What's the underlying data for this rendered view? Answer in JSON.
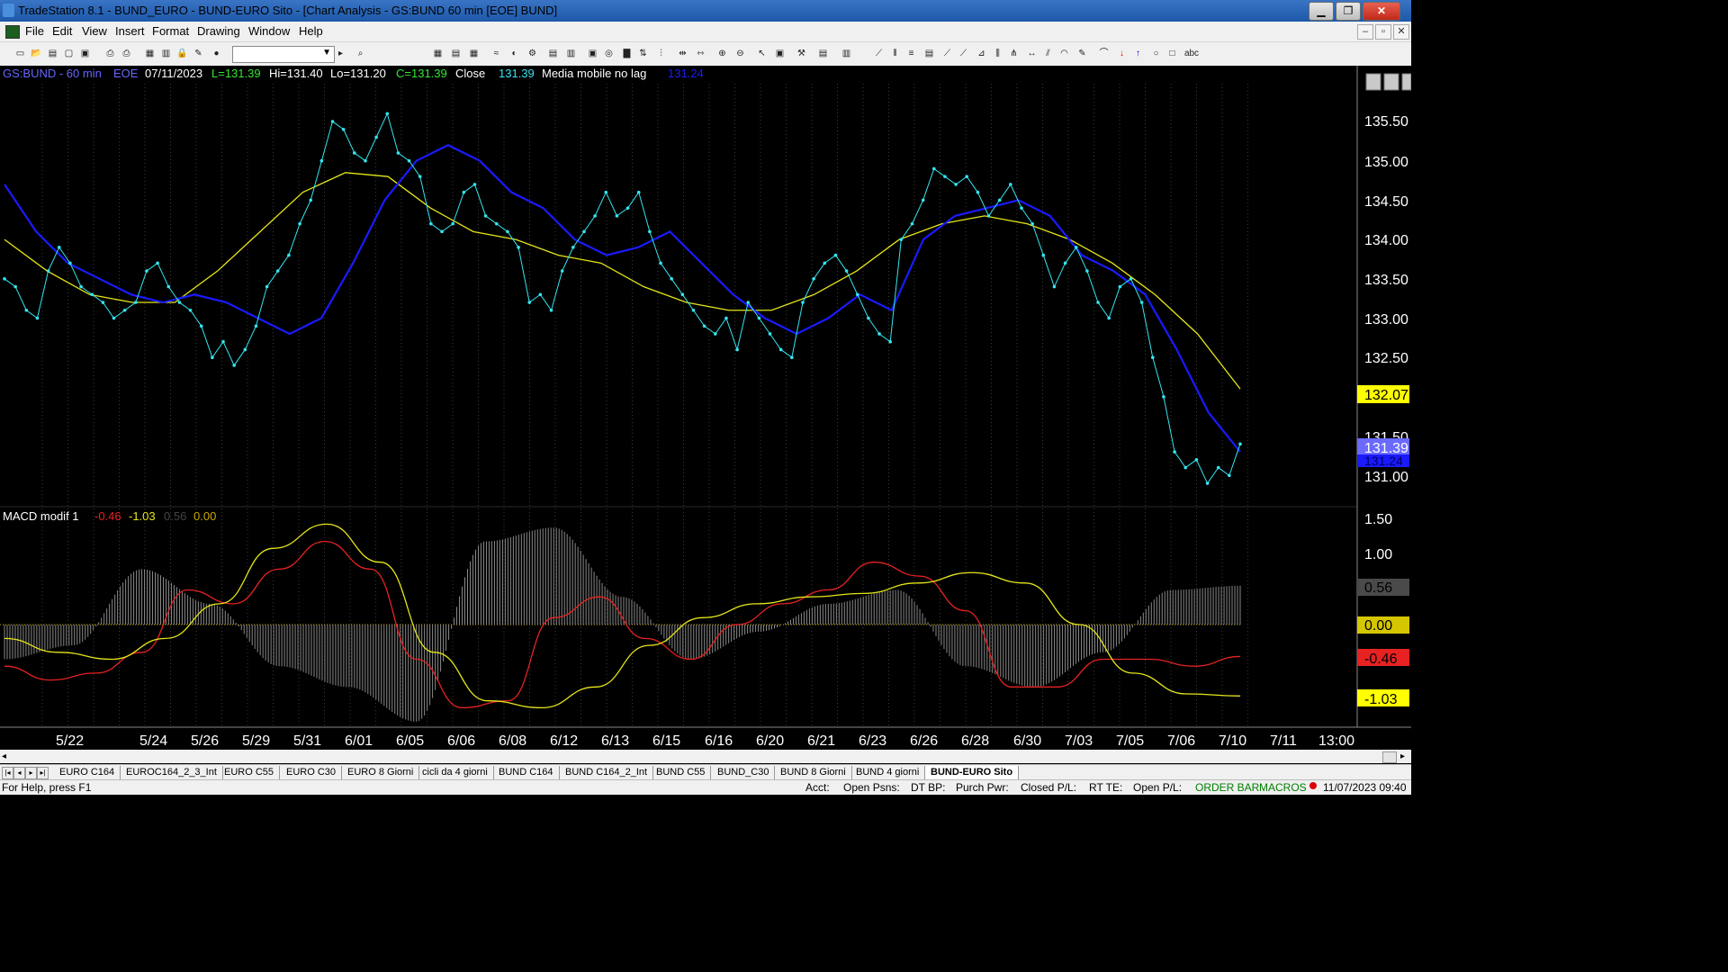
{
  "window": {
    "title": "TradeStation 8.1 - BUND_EURO - BUND-EURO Sito - [Chart Analysis - GS:BUND  60 min  [EOE] BUND]",
    "minimize": "▁",
    "maximize": "❐",
    "close": "✕"
  },
  "menu": [
    "File",
    "Edit",
    "View",
    "Insert",
    "Format",
    "Drawing",
    "Window",
    "Help"
  ],
  "mdi_controls": [
    "–",
    "▫",
    "✕"
  ],
  "toolbar": {
    "combo_value": ""
  },
  "chart_header": {
    "symbol": "GS:BUND - 60 min",
    "session": "EOE",
    "date": "07/11/2023",
    "last": "L=131.39",
    "high": "Hi=131.40",
    "low": "Lo=131.20",
    "close": "C=131.39",
    "close_label": "Close",
    "close_value": "131.39",
    "indicator": "Media mobile no lag",
    "indicator_value": "131.24"
  },
  "macd_header": {
    "name": "MACD modif 1",
    "v1": "-0.46",
    "v2": "-1.03",
    "v3": "0.56",
    "v4": "0.00"
  },
  "price_axis": [
    "135.50",
    "135.00",
    "134.50",
    "134.00",
    "133.50",
    "133.00",
    "132.50",
    "131.50",
    "131.00"
  ],
  "price_tags": {
    "yellow": "132.07",
    "close": "131.39",
    "blue": "131.24"
  },
  "macd_axis": [
    "1.50",
    "1.00"
  ],
  "macd_tags": {
    "hist": "0.56",
    "zero": "0.00",
    "macd": "-0.46",
    "signal": "-1.03"
  },
  "date_axis": [
    "5/22",
    "5/24",
    "5/26",
    "5/29",
    "5/31",
    "6/01",
    "6/05",
    "6/06",
    "6/08",
    "6/12",
    "6/13",
    "6/15",
    "6/16",
    "6/20",
    "6/21",
    "6/23",
    "6/26",
    "6/28",
    "6/30",
    "7/03",
    "7/05",
    "7/06",
    "7/10",
    "7/11",
    "13:00"
  ],
  "workspace_tabs": [
    "EURO C164",
    "EUROC164_2_3_Int",
    "EURO C55",
    "EURO C30",
    "EURO 8 Giorni",
    "cicli da 4 giorni",
    "BUND C164",
    "BUND C164_2_Int",
    "BUND C55",
    "BUND_C30",
    "BUND 8 Giorni",
    "BUND 4 giorni",
    "BUND-EURO Sito"
  ],
  "status": {
    "help": "For Help, press F1",
    "acct": "Acct:",
    "open_psns": "Open Psns:",
    "dt_bp": "DT BP:",
    "purch_pwr": "Purch Pwr:",
    "closed_pl": "Closed P/L:",
    "rt_te": "RT TE:",
    "open_pl": "Open P/L:",
    "order_bar": "ORDER BAR",
    "macros": "MACROS",
    "datetime": "11/07/2023 09:40"
  },
  "chart_data": [
    {
      "type": "line",
      "title": "GS:BUND - 60 min",
      "ylim": [
        131.0,
        135.7
      ],
      "series": [
        {
          "name": "Close",
          "color": "#33e6f0",
          "values": [
            133.5,
            133.4,
            133.1,
            133.0,
            133.6,
            133.9,
            133.7,
            133.4,
            133.3,
            133.2,
            133.0,
            133.1,
            133.2,
            133.6,
            133.7,
            133.4,
            133.2,
            133.1,
            132.9,
            132.5,
            132.7,
            132.4,
            132.6,
            132.9,
            133.4,
            133.6,
            133.8,
            134.2,
            134.5,
            135.0,
            135.5,
            135.4,
            135.1,
            135.0,
            135.3,
            135.6,
            135.1,
            135.0,
            134.8,
            134.2,
            134.1,
            134.2,
            134.6,
            134.7,
            134.3,
            134.2,
            134.1,
            133.9,
            133.2,
            133.3,
            133.1,
            133.6,
            133.9,
            134.1,
            134.3,
            134.6,
            134.3,
            134.4,
            134.6,
            134.1,
            133.7,
            133.5,
            133.3,
            133.1,
            132.9,
            132.8,
            133.0,
            132.6,
            133.2,
            133.0,
            132.8,
            132.6,
            132.5,
            133.2,
            133.5,
            133.7,
            133.8,
            133.6,
            133.3,
            133.0,
            132.8,
            132.7,
            134.0,
            134.2,
            134.5,
            134.9,
            134.8,
            134.7,
            134.8,
            134.6,
            134.3,
            134.5,
            134.7,
            134.4,
            134.2,
            133.8,
            133.4,
            133.7,
            133.9,
            133.6,
            133.2,
            133.0,
            133.4,
            133.5,
            133.2,
            132.5,
            132.0,
            131.3,
            131.1,
            131.2,
            130.9,
            131.1,
            131.0,
            131.4
          ]
        },
        {
          "name": "Media mobile no lag",
          "color": "#1a1aff",
          "values": [
            134.7,
            134.1,
            133.7,
            133.5,
            133.3,
            133.2,
            133.3,
            133.2,
            133.0,
            132.8,
            133.0,
            133.7,
            134.5,
            135.0,
            135.2,
            135.0,
            134.6,
            134.4,
            134.0,
            133.8,
            133.9,
            134.1,
            133.7,
            133.3,
            133.0,
            132.8,
            133.0,
            133.3,
            133.1,
            134.0,
            134.3,
            134.4,
            134.5,
            134.3,
            133.8,
            133.6,
            133.3,
            132.6,
            131.8,
            131.3
          ]
        },
        {
          "name": "",
          "color": "#e6e619",
          "values": [
            134.0,
            133.6,
            133.3,
            133.2,
            133.2,
            133.6,
            134.1,
            134.6,
            134.85,
            134.8,
            134.4,
            134.1,
            134.0,
            133.8,
            133.7,
            133.4,
            133.2,
            133.1,
            133.1,
            133.3,
            133.6,
            134.0,
            134.2,
            134.3,
            134.2,
            134.0,
            133.7,
            133.3,
            132.8,
            132.1
          ]
        }
      ]
    },
    {
      "type": "line",
      "title": "MACD modif 1",
      "ylim": [
        -1.5,
        1.5
      ],
      "series": [
        {
          "name": "",
          "color": "#e62222",
          "values": [
            -0.6,
            -0.8,
            -0.7,
            -0.4,
            0.5,
            0.3,
            0.8,
            1.2,
            0.8,
            -0.5,
            -1.2,
            -1.1,
            0.1,
            0.4,
            -0.2,
            -0.5,
            0.0,
            0.3,
            0.5,
            0.9,
            0.7,
            0.2,
            -0.9,
            -0.9,
            -0.5,
            -0.5,
            -0.6,
            -0.46
          ]
        },
        {
          "name": "",
          "color": "#e6e619",
          "values": [
            -0.2,
            -0.4,
            -0.5,
            -0.2,
            0.3,
            1.1,
            1.45,
            0.9,
            -0.4,
            -1.1,
            -1.2,
            -0.9,
            -0.3,
            0.1,
            0.3,
            0.4,
            0.45,
            0.6,
            0.75,
            0.6,
            0.0,
            -0.7,
            -1.0,
            -1.03
          ]
        },
        {
          "name": "",
          "color": "#9a9a9a",
          "values": [
            -0.5,
            -0.3,
            0.8,
            0.3,
            -0.6,
            -0.9,
            -1.4,
            1.2,
            1.4,
            0.4,
            -0.5,
            -0.1,
            0.3,
            0.5,
            -0.6,
            -0.9,
            -0.4,
            0.5,
            0.56
          ]
        }
      ]
    }
  ]
}
